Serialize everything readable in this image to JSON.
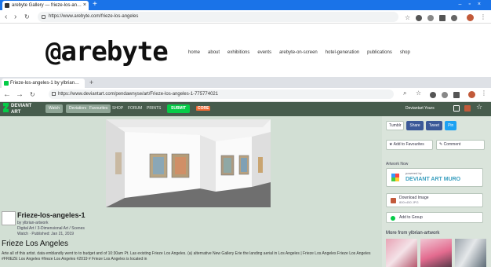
{
  "outer_browser": {
    "tab_title": "arebyte Gallery — frieze-los-an…",
    "url": "https://www.arebyte.com/frieze-los-angeles"
  },
  "arebyte": {
    "logo": "@arebyte",
    "nav": [
      "home",
      "about",
      "exhibitions",
      "events",
      "arebyte-on-screen",
      "hotel-generation",
      "publications",
      "shop"
    ]
  },
  "inner_browser": {
    "tab_title": "Frieze-los-angeles-1 by ylbrian…",
    "url": "https://www.deviantart.com/pendawnyse/art/Frieze-los-angeles-1-775774021"
  },
  "da_header": {
    "logo_line1": "DEVIANT",
    "logo_line2": "ART",
    "buttons": [
      "Watch",
      "Deviations",
      "Favourites"
    ],
    "links": [
      "SHOP",
      "FORUM",
      "PRINTS"
    ],
    "submit": "SUBMIT",
    "core_label": "CORE",
    "user": "Deviantart Yours"
  },
  "deviation": {
    "title": "Frieze-los-angeles-1",
    "meta_line1": "by ylbrian-artwork",
    "meta_line2": "Digital Art / 3-Dimensional Art / Scenes",
    "meta_line3": "Watch · Published: Jan 21, 2019"
  },
  "section_heading": "Frieze Los Angeles",
  "description": "Arte all of this artist. data emblandly went to to budget and of 10:30am Pt. Las existing Frieze Los Angeles. (a) alternative New Gallery Erie the landing aerial in Los Angeles | Frieze Los Angeles Frieze Los Angeles #FRIEZE Los Angeles #frieze Los Angeles #2019 # Frieze Los Angeles is located in",
  "sidebar": {
    "share_buttons": [
      "Tumblr",
      "Share",
      "Tweet",
      "Pin"
    ],
    "actions": [
      "Add to Favourites",
      "Comment"
    ],
    "muro_label": "Artwork Now",
    "muro_sub": "powered by",
    "muro_brand": "DEVIANT ART MURO",
    "download_label": "Download Image",
    "download_sub": "800×450 JPG",
    "group_label": "Add to Group",
    "more_label": "More from ylbrian-artwork"
  },
  "colors": {
    "da_green": "#05cc47",
    "da_header": "#475c4d",
    "da_bg": "#d2dfd4"
  }
}
